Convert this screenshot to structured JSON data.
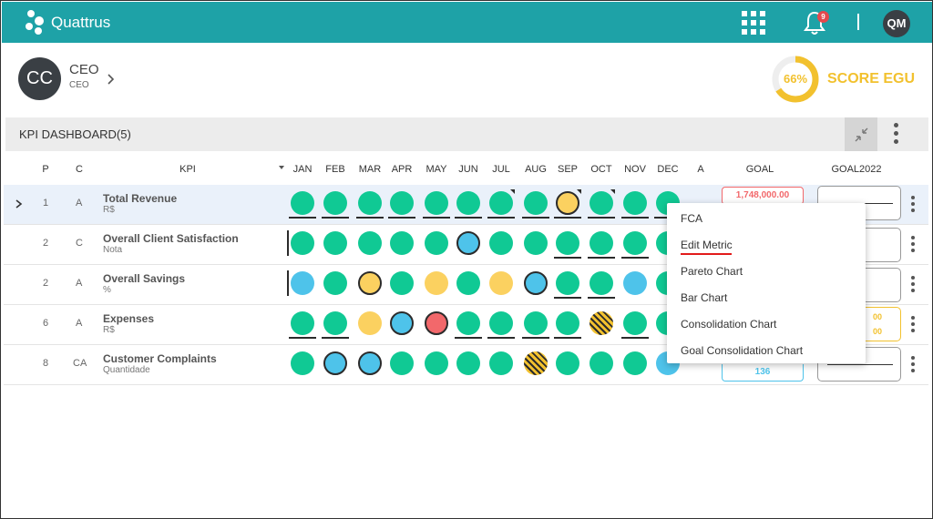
{
  "app": {
    "name": "Quattrus",
    "notifications": "9",
    "user_initials": "QM"
  },
  "profile": {
    "initials": "CC",
    "name": "CEO",
    "role": "CEO"
  },
  "score": {
    "value": "66%",
    "fraction": 0.66,
    "label": "SCORE EGU",
    "color": "#f2c12e"
  },
  "dashboard": {
    "title": "KPI DASHBOARD(5)"
  },
  "headers": {
    "p": "P",
    "c": "C",
    "kpi": "KPI",
    "months": [
      "JAN",
      "FEB",
      "MAR",
      "APR",
      "MAY",
      "JUN",
      "JUL",
      "AUG",
      "SEP",
      "OCT",
      "NOV",
      "DEC"
    ],
    "a": "A",
    "goal": "GOAL",
    "goal2022": "GOAL2022"
  },
  "rows": [
    {
      "p": "1",
      "c": "A",
      "name": "Total Revenue",
      "unit": "R$",
      "goal": "1,748,000.00",
      "goal2022": ""
    },
    {
      "p": "2",
      "c": "C",
      "name": "Overall Client Satisfaction",
      "unit": "Nota",
      "goal": "",
      "goal2022": ""
    },
    {
      "p": "2",
      "c": "A",
      "name": "Overall Savings",
      "unit": "%",
      "goal": "",
      "goal2022": ""
    },
    {
      "p": "6",
      "c": "A",
      "name": "Expenses",
      "unit": "R$",
      "goal": "",
      "goal2022": "00",
      "goal2022_b": "00"
    },
    {
      "p": "8",
      "c": "CA",
      "name": "Customer Complaints",
      "unit": "Quantidade",
      "goal": "136",
      "goal2022": ""
    }
  ],
  "status_colors": {
    "green": "#10c994",
    "blue": "#4ec3ea",
    "yellow": "#fbd160",
    "red": "#f2686b"
  },
  "menu": {
    "items": [
      "FCA",
      "Edit Metric",
      "Pareto Chart",
      "Bar Chart",
      "Consolidation Chart",
      "Goal Consolidation Chart"
    ]
  }
}
